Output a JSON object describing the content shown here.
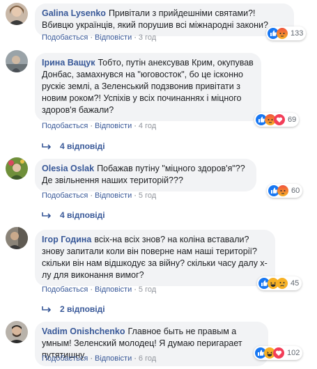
{
  "comments": [
    {
      "author": "Galina Lysenko",
      "text": "Привітали з прийдешніми святами?! Вбивцю українців, який порушив всі міжнародні закони?",
      "like": "Подобається",
      "reply": "Відповісти",
      "time": "3 год",
      "reaction_count": "133"
    },
    {
      "author": "Ірина Ващук",
      "text": "Тобто, путін анексував Крим, окупував Донбас, замахнувся на \"юговосток\", бо це ісконно рускіє землі, а Зеленський подзвонив привітати з новим роком?! Успіхів у всіх починаннях і міцного здоров'я бажали?",
      "like": "Подобається",
      "reply": "Відповісти",
      "time": "4 год",
      "reaction_count": "69",
      "replies_label": "4 відповіді"
    },
    {
      "author": "Olesia Oslak",
      "text": "Побажав путіну \"міцного здоров'я\"?? Де звільнення наших територій???",
      "like": "Подобається",
      "reply": "Відповісти",
      "time": "5 год",
      "reaction_count": "60",
      "replies_label": "4 відповіді"
    },
    {
      "author": "Ігор Година",
      "text": "всіх-на всіх знов? на коліна вставали? знову запитали коли він поверне нам наші території? скільки він нам відшкодує за війну? скільки часу далу х-лу для виконання вимог?",
      "like": "Подобається",
      "reply": "Відповісти",
      "time": "5 год",
      "reaction_count": "45",
      "replies_label": "2 відповіді"
    },
    {
      "author": "Vadim Onishchenko",
      "text": "Главное быть не правым а умным! Зеленский молодец! Я думаю перигарает путятишну.",
      "like": "Подобається",
      "reply": "Відповісти",
      "time": "6 год",
      "reaction_count": "102"
    }
  ],
  "colors": {
    "link": "#385898",
    "bubble": "#f2f3f5",
    "like": "#1877f2",
    "angry": "#f28b2e",
    "love": "#f33e58",
    "haha": "#f7b125"
  }
}
